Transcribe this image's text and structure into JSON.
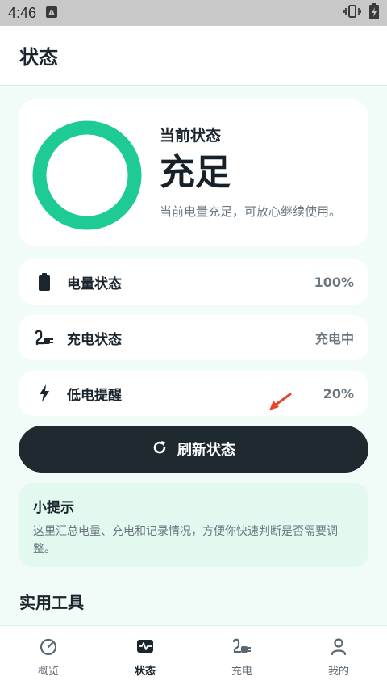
{
  "status_bar": {
    "time": "4:46",
    "notification_icon": "a-icon",
    "icons": [
      "vibrate-icon",
      "battery-full-icon"
    ]
  },
  "app_bar": {
    "title": "状态"
  },
  "hero": {
    "label": "当前状态",
    "value": "充足",
    "description": "当前电量充足，可放心继续使用。",
    "ring_color": "#1ecb95",
    "battery_fraction": 1.0
  },
  "rows": [
    {
      "icon": "battery-icon",
      "label": "电量状态",
      "value": "100%"
    },
    {
      "icon": "plug-icon",
      "label": "充电状态",
      "value": "充电中"
    },
    {
      "icon": "lightning-icon",
      "label": "低电提醒",
      "value": "20%"
    }
  ],
  "refresh_button": {
    "icon": "refresh-icon",
    "label": "刷新状态"
  },
  "tip": {
    "title": "小提示",
    "text": "这里汇总电量、充电和记录情况，方便你快速判断是否需要调整。"
  },
  "tools_section": {
    "title": "实用工具"
  },
  "tab_bar": {
    "tabs": [
      {
        "icon": "gauge-icon",
        "label": "概览",
        "active": false
      },
      {
        "icon": "pulse-icon",
        "label": "状态",
        "active": true
      },
      {
        "icon": "plug-icon",
        "label": "充电",
        "active": false
      },
      {
        "icon": "person-icon",
        "label": "我的",
        "active": false
      }
    ]
  },
  "colors": {
    "accent": "#1ecb95",
    "dark_button": "#1f2930",
    "background": "#f1fbf7",
    "annotation_arrow": "#e8452c"
  }
}
